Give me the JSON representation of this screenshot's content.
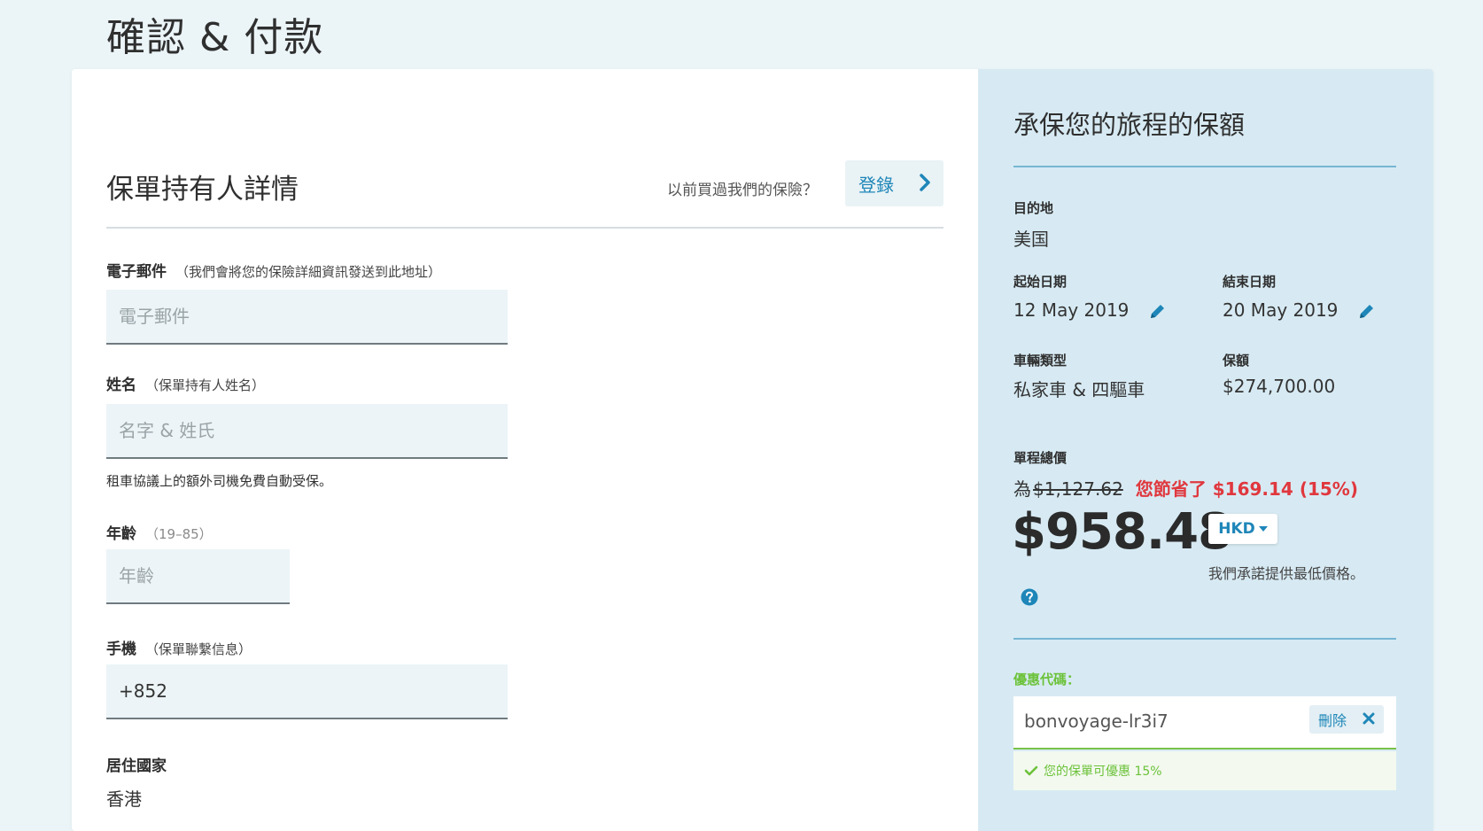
{
  "page": {
    "title": "確認 & 付款"
  },
  "policyholder": {
    "section_title": "保單持有人詳情",
    "login_prompt": "以前買過我們的保險？",
    "login_label": "登錄",
    "email": {
      "label": "電子郵件",
      "hint": "（我們會將您的保險詳細資訊發送到此地址）",
      "placeholder": "電子郵件",
      "value": ""
    },
    "name": {
      "label": "姓名",
      "hint": "（保單持有人姓名）",
      "placeholder": "名字 & 姓氏",
      "value": ""
    },
    "note": "租車協議上的額外司機免費自動受保。",
    "age": {
      "label": "年齡",
      "hint": "（19–85）",
      "placeholder": "年齡",
      "value": ""
    },
    "mobile": {
      "label": "手機",
      "hint": "（保單聯繫信息）",
      "value": "+852"
    },
    "residence": {
      "label": "居住國家",
      "value": "香港"
    }
  },
  "summary": {
    "title": "承保您的旅程的保額",
    "destination_label": "目的地",
    "destination_value": "美国",
    "start_label": "起始日期",
    "start_value": "12 May 2019",
    "end_label": "結束日期",
    "end_value": "20 May 2019",
    "vehicle_label": "車輛類型",
    "vehicle_value": "私家車 & 四驅車",
    "coverage_label": "保額",
    "coverage_value": "$274,700.00",
    "total_label": "單程總價",
    "was_prefix": "為",
    "old_price": "$1,127.62",
    "savings_text": "您節省了 $169.14 (15%)",
    "price": "$958.48",
    "currency": "HKD",
    "price_promise": "我們承諾提供最低價格。",
    "promo_label": "優惠代碼：",
    "promo_code": "bonvoyage-lr3i7",
    "remove_label": "刪除",
    "promo_status": "您的保單可優惠 15%"
  },
  "colors": {
    "accent": "#1e86b8",
    "savings": "#e0383e",
    "success": "#6cc23a",
    "summary_bg": "#d7eaf3",
    "page_bg": "#ebf4f7"
  },
  "icons": {
    "login_chevron": "chevron-right-icon",
    "edit": "pencil-icon",
    "help": "question-circle-icon",
    "remove": "close-icon",
    "status": "check-icon",
    "currency_caret": "caret-down-icon"
  }
}
